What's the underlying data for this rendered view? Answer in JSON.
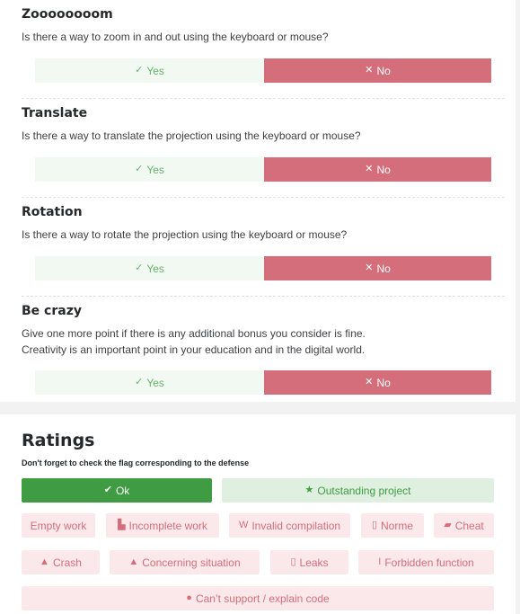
{
  "sections": [
    {
      "title": "Zoooooooom",
      "description": [
        "Is there a way to zoom in and out using the keyboard or mouse?"
      ],
      "yes_label": "Yes",
      "no_label": "No"
    },
    {
      "title": "Translate",
      "description": [
        "Is there a way to translate the projection using the keyboard or mouse?"
      ],
      "yes_label": "Yes",
      "no_label": "No"
    },
    {
      "title": "Rotation",
      "description": [
        "Is there a way to rotate the projection using the keyboard or mouse?"
      ],
      "yes_label": "Yes",
      "no_label": "No"
    },
    {
      "title": "Be crazy",
      "description": [
        "Give one more point if there is any additional bonus you consider is fine.",
        "Creativity is an important point in your education and in the digital world."
      ],
      "yes_label": "Yes",
      "no_label": "No"
    }
  ],
  "ratings": {
    "title": "Ratings",
    "note": "Don't forget to check the flag corresponding to the defense",
    "ok_label": "Ok",
    "outstanding_label": "Outstanding project",
    "flags": {
      "empty_work": "Empty work",
      "incomplete_work": "Incomplete work",
      "invalid_compilation": "Invalid compilation",
      "norme": "Norme",
      "cheat": "Cheat",
      "crash": "Crash",
      "concerning_situation": "Concerning situation",
      "leaks": "Leaks",
      "forbidden_function": "Forbidden function",
      "cant_support": "Can’t support / explain code"
    }
  },
  "colors": {
    "yes_bg": "#f1f9f2",
    "yes_text": "#67b36c",
    "no_bg": "#d46e7b",
    "ok_bg": "#3f9c42",
    "outstanding_bg": "#dff0e0",
    "flag_bg": "#fbe8ea",
    "flag_text": "#d46e7b"
  },
  "icons": {
    "yes": "check-circle-icon",
    "no": "x-icon",
    "ok": "check-icon",
    "outstanding": "star-icon",
    "incomplete": "file-icon",
    "invalid_compilation": "w-icon",
    "norme": "square-icon",
    "cheat": "eraser-icon",
    "crash": "fire-extinguisher-icon",
    "concerning": "warning-icon",
    "leaks": "square-icon",
    "forbidden": "i-icon",
    "cant_support": "speech-bubble-icon"
  }
}
